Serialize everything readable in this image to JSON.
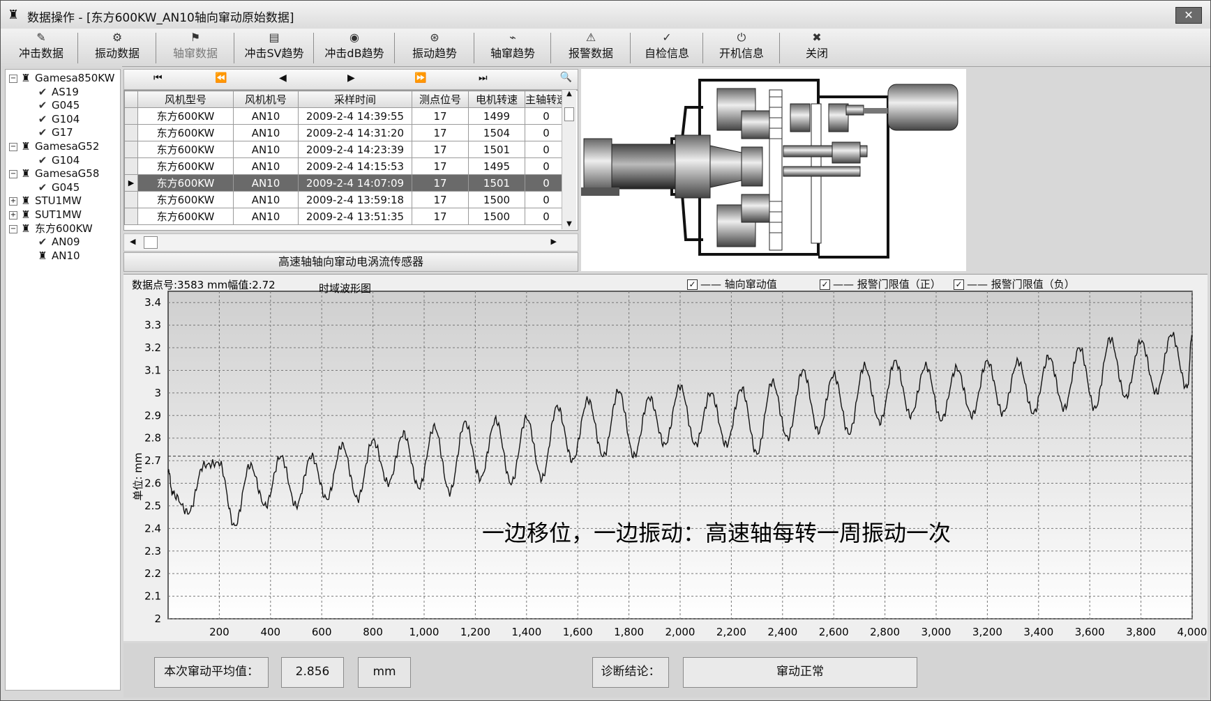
{
  "window": {
    "title": "数据操作 - [东方600KW_AN10轴向窜动原始数据]",
    "close": "✕"
  },
  "toolbar": [
    {
      "label": "冲击数据",
      "icon": "impact-data-icon",
      "enabled": true
    },
    {
      "label": "振动数据",
      "icon": "vibration-data-icon",
      "enabled": true
    },
    {
      "label": "轴窜数据",
      "icon": "axial-data-icon",
      "enabled": false
    },
    {
      "label": "冲击SV趋势",
      "icon": "impact-sv-trend-icon",
      "enabled": true
    },
    {
      "label": "冲击dB趋势",
      "icon": "impact-db-trend-icon",
      "enabled": true
    },
    {
      "label": "振动趋势",
      "icon": "vibration-trend-icon",
      "enabled": true
    },
    {
      "label": "轴窜趋势",
      "icon": "axial-trend-icon",
      "enabled": true
    },
    {
      "label": "报警数据",
      "icon": "alarm-data-icon",
      "enabled": true
    },
    {
      "label": "自检信息",
      "icon": "self-check-icon",
      "enabled": true
    },
    {
      "label": "开机信息",
      "icon": "startup-info-icon",
      "enabled": true
    },
    {
      "label": "关闭",
      "icon": "close-icon",
      "enabled": true
    }
  ],
  "tree": [
    {
      "label": "Gamesa850KW",
      "level": 0,
      "expander": "−",
      "icon": "turbine"
    },
    {
      "label": "AS19",
      "level": 1,
      "icon": "check"
    },
    {
      "label": "G045",
      "level": 1,
      "icon": "check"
    },
    {
      "label": "G104",
      "level": 1,
      "icon": "check"
    },
    {
      "label": "G17",
      "level": 1,
      "icon": "check"
    },
    {
      "label": "GamesaG52",
      "level": 0,
      "expander": "−",
      "icon": "turbine"
    },
    {
      "label": "G104",
      "level": 1,
      "icon": "check"
    },
    {
      "label": "GamesaG58",
      "level": 0,
      "expander": "−",
      "icon": "turbine"
    },
    {
      "label": "G045",
      "level": 1,
      "icon": "check"
    },
    {
      "label": "STU1MW",
      "level": 0,
      "expander": "+",
      "icon": "turbine"
    },
    {
      "label": "SUT1MW",
      "level": 0,
      "expander": "+",
      "icon": "turbine"
    },
    {
      "label": "东方600KW",
      "level": 0,
      "expander": "−",
      "icon": "turbine"
    },
    {
      "label": "AN09",
      "level": 1,
      "icon": "check"
    },
    {
      "label": "AN10",
      "level": 1,
      "icon": "turbine"
    }
  ],
  "nav": [
    "⏮",
    "⏪",
    "◀",
    "▶",
    "⏩",
    "⏭"
  ],
  "table": {
    "headers": [
      "风机型号",
      "风机机号",
      "采样时间",
      "测点位号",
      "电机转速",
      "主轴转速"
    ],
    "rows": [
      [
        "东方600KW",
        "AN10",
        "2009-2-4 14:39:55",
        "17",
        "1499",
        "0"
      ],
      [
        "东方600KW",
        "AN10",
        "2009-2-4 14:31:20",
        "17",
        "1504",
        "0"
      ],
      [
        "东方600KW",
        "AN10",
        "2009-2-4 14:23:39",
        "17",
        "1501",
        "0"
      ],
      [
        "东方600KW",
        "AN10",
        "2009-2-4 14:15:53",
        "17",
        "1495",
        "0"
      ],
      [
        "东方600KW",
        "AN10",
        "2009-2-4 14:07:09",
        "17",
        "1501",
        "0"
      ],
      [
        "东方600KW",
        "AN10",
        "2009-2-4 13:59:18",
        "17",
        "1500",
        "0"
      ],
      [
        "东方600KW",
        "AN10",
        "2009-2-4 13:51:35",
        "17",
        "1500",
        "0"
      ]
    ],
    "selected_index": 4
  },
  "sensor_label": "高速轴轴向窜动电涡流传感器",
  "chart_info": {
    "points_text": "数据点号:3583  mm幅值:2.72",
    "chart_title": "时域波形图",
    "ylabel": "单位: mm"
  },
  "legend": [
    {
      "label": "—— 轴向窜动值",
      "checked": true
    },
    {
      "label": "—— 报警门限值（正）",
      "checked": true
    },
    {
      "label": "—— 报警门限值（负）",
      "checked": true
    }
  ],
  "chart_data": {
    "type": "line",
    "title": "时域波形图",
    "xlabel": "",
    "ylabel": "单位: mm",
    "xlim": [
      0,
      4000
    ],
    "ylim": [
      2,
      3.45
    ],
    "x_ticks": [
      200,
      400,
      600,
      800,
      1000,
      1200,
      1400,
      1600,
      1800,
      2000,
      2200,
      2400,
      2600,
      2800,
      3000,
      3200,
      3400,
      3600,
      3800,
      4000
    ],
    "x_tick_labels": [
      "200",
      "400",
      "600",
      "800",
      "1,000",
      "1,200",
      "1,400",
      "1,600",
      "1,800",
      "2,000",
      "2,200",
      "2,400",
      "2,600",
      "2,800",
      "3,000",
      "3,200",
      "3,400",
      "3,600",
      "3,800",
      "4,000"
    ],
    "y_ticks": [
      2,
      2.1,
      2.2,
      2.3,
      2.4,
      2.5,
      2.6,
      2.7,
      2.8,
      2.9,
      3,
      3.1,
      3.2,
      3.3,
      3.4
    ],
    "grid": true,
    "reference_line": 2.72,
    "annotation": "一边移位，一边振动：高速轴每转一周振动一次",
    "series": [
      {
        "name": "轴向窜动值",
        "x": [
          0,
          20,
          80,
          140,
          200,
          260,
          320,
          380,
          440,
          500,
          560,
          620,
          680,
          740,
          800,
          860,
          920,
          980,
          1040,
          1100,
          1160,
          1220,
          1280,
          1340,
          1400,
          1460,
          1520,
          1580,
          1640,
          1700,
          1760,
          1820,
          1880,
          1940,
          2000,
          2060,
          2120,
          2180,
          2240,
          2300,
          2360,
          2420,
          2480,
          2540,
          2600,
          2660,
          2720,
          2780,
          2840,
          2900,
          2960,
          3020,
          3080,
          3140,
          3200,
          3260,
          3320,
          3380,
          3440,
          3500,
          3560,
          3620,
          3680,
          3740,
          3800,
          3860,
          3920,
          3980,
          4000
        ],
        "y": [
          2.65,
          2.55,
          2.47,
          2.68,
          2.69,
          2.41,
          2.68,
          2.5,
          2.72,
          2.5,
          2.72,
          2.53,
          2.77,
          2.53,
          2.79,
          2.6,
          2.82,
          2.58,
          2.85,
          2.56,
          2.87,
          2.62,
          2.88,
          2.6,
          2.89,
          2.62,
          2.94,
          2.7,
          2.97,
          2.72,
          3.01,
          2.72,
          2.98,
          2.77,
          3.03,
          2.77,
          3.0,
          2.77,
          3.02,
          2.73,
          3.05,
          2.8,
          3.1,
          2.83,
          3.08,
          2.82,
          3.12,
          2.87,
          3.14,
          2.9,
          3.12,
          2.88,
          3.11,
          2.9,
          3.14,
          2.91,
          3.14,
          2.91,
          3.16,
          2.93,
          3.2,
          2.93,
          3.24,
          2.98,
          3.23,
          3.0,
          3.26,
          3.02,
          3.25
        ]
      }
    ]
  },
  "bottom": {
    "avg_label": "本次窜动平均值：",
    "avg_value": "2.856",
    "unit": "mm",
    "diag_label": "诊断结论：",
    "diag_value": "窜动正常"
  }
}
